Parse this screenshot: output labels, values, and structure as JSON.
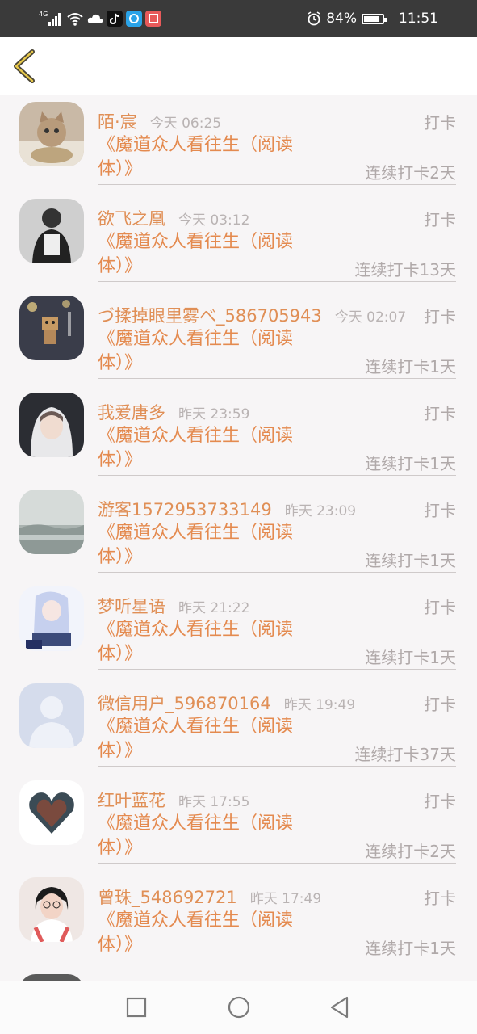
{
  "status_bar": {
    "network": "4G",
    "battery": "84%",
    "battery_level": 0.84,
    "time": "11:51",
    "icons": [
      "signal-icon",
      "wifi-icon",
      "cloud-icon",
      "tiktok-icon",
      "browser-icon",
      "reader-icon",
      "alarm-icon",
      "battery-icon"
    ]
  },
  "colors": {
    "accent": "#e08f56",
    "muted": "#b0a9a9",
    "status_bar": "#3a3a3a",
    "background": "#f7f5f6"
  },
  "header": {
    "back_icon": "chevron-left-icon"
  },
  "entries": [
    {
      "name": "陌·宸",
      "time": "今天 06:25",
      "checkin": "打卡",
      "book": "《魔道众人看往生（阅读体）》",
      "streak": "连续打卡2天",
      "avatar": "cat-avatar"
    },
    {
      "name": "欲飞之凰",
      "time": "今天 03:12",
      "checkin": "打卡",
      "book": "《魔道众人看往生（阅读体）》",
      "streak": "连续打卡13天",
      "avatar": "person-avatar"
    },
    {
      "name": "づ揉掉眼里雾べ_586705943",
      "time": "今天 02:07",
      "checkin": "打卡",
      "book": "《魔道众人看往生（阅读体）》",
      "streak": "连续打卡1天",
      "avatar": "danbo-avatar"
    },
    {
      "name": "我爱唐多",
      "time": "昨天 23:59",
      "checkin": "打卡",
      "book": "《魔道众人看往生（阅读体）》",
      "streak": "连续打卡1天",
      "avatar": "anime-hoodie-avatar"
    },
    {
      "name": "游客1572953733149",
      "time": "昨天 23:09",
      "checkin": "打卡",
      "book": "《魔道众人看往生（阅读体）》",
      "streak": "连续打卡1天",
      "avatar": "landscape-avatar"
    },
    {
      "name": "梦听星语",
      "time": "昨天 21:22",
      "checkin": "打卡",
      "book": "《魔道众人看往生（阅读体）》",
      "streak": "连续打卡1天",
      "avatar": "anime-girl-avatar"
    },
    {
      "name": "微信用户_596870164",
      "time": "昨天 19:49",
      "checkin": "打卡",
      "book": "《魔道众人看往生（阅读体）》",
      "streak": "连续打卡37天",
      "avatar": "default-avatar"
    },
    {
      "name": "红叶蓝花",
      "time": "昨天 17:55",
      "checkin": "打卡",
      "book": "《魔道众人看往生（阅读体）》",
      "streak": "连续打卡2天",
      "avatar": "heart-avatar"
    },
    {
      "name": "曾珠_548692721",
      "time": "昨天 17:49",
      "checkin": "打卡",
      "book": "《魔道众人看往生（阅读体）》",
      "streak": "连续打卡1天",
      "avatar": "girl-avatar"
    }
  ],
  "nav_bar": {
    "icons": [
      "recent-apps-icon",
      "home-icon",
      "back-icon"
    ]
  }
}
